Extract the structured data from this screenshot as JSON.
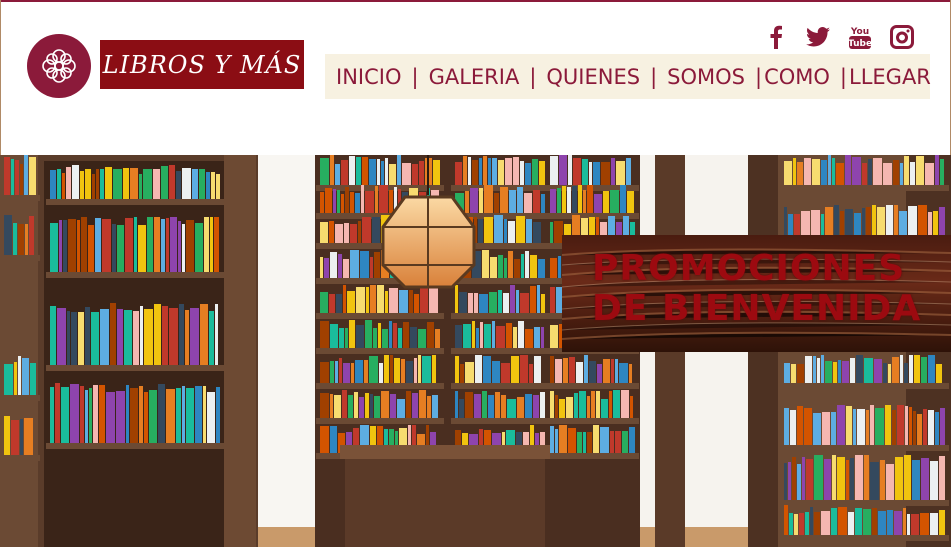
{
  "brand": {
    "name": "LIBROS Y MÁS",
    "logo_icon": "mandala-icon",
    "primary_color": "#8b1a3a",
    "banner_color": "#8b0d14"
  },
  "social": [
    {
      "name": "facebook-icon",
      "glyph": "f"
    },
    {
      "name": "twitter-icon",
      "glyph": "bird"
    },
    {
      "name": "youtube-icon",
      "glyph": "You Tube"
    },
    {
      "name": "instagram-icon",
      "glyph": "camera"
    }
  ],
  "nav": {
    "items": [
      "INICIO",
      "GALERIA",
      "QUIENES",
      "SOMOS",
      "COMO",
      "LLEGAR"
    ],
    "separator": "|",
    "background": "#f7f1e1"
  },
  "hero": {
    "promo_line1": "PROMOCIONES",
    "promo_line2": "DE BIENVENIDA",
    "promo_text_color": "#9c0a10"
  }
}
